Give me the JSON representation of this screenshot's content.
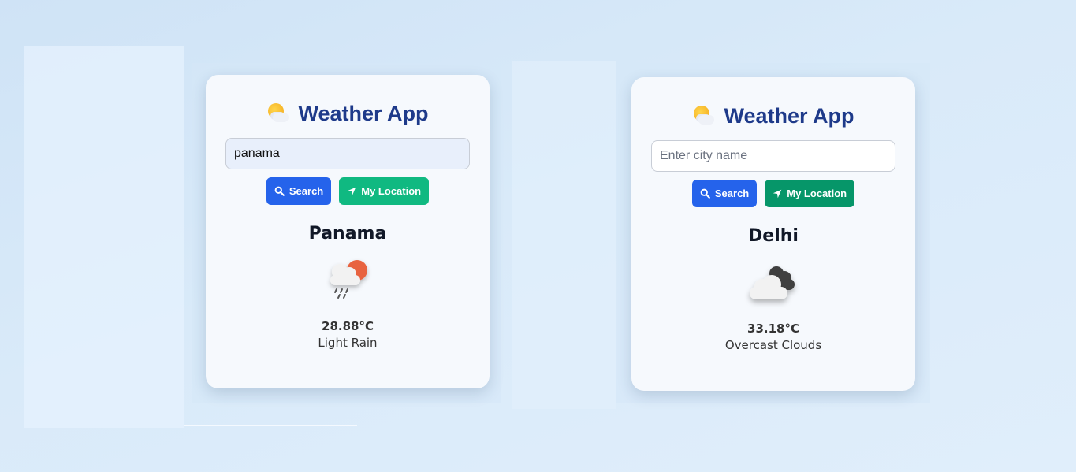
{
  "app": {
    "title": "Weather App"
  },
  "cards": [
    {
      "input_value": "panama",
      "placeholder": "Enter city name",
      "search_label": "Search",
      "location_label": "My Location",
      "city": "Panama",
      "temperature": "28.88°C",
      "description": "Light Rain",
      "weather_icon": "light-rain-icon"
    },
    {
      "input_value": "",
      "placeholder": "Enter city name",
      "search_label": "Search",
      "location_label": "My Location",
      "city": "Delhi",
      "temperature": "33.18°C",
      "description": "Overcast Clouds",
      "weather_icon": "overcast-clouds-icon"
    }
  ],
  "colors": {
    "title": "#1e3a8a",
    "search_button": "#2563eb",
    "location_button_1": "#10b981",
    "location_button_2": "#069669"
  }
}
